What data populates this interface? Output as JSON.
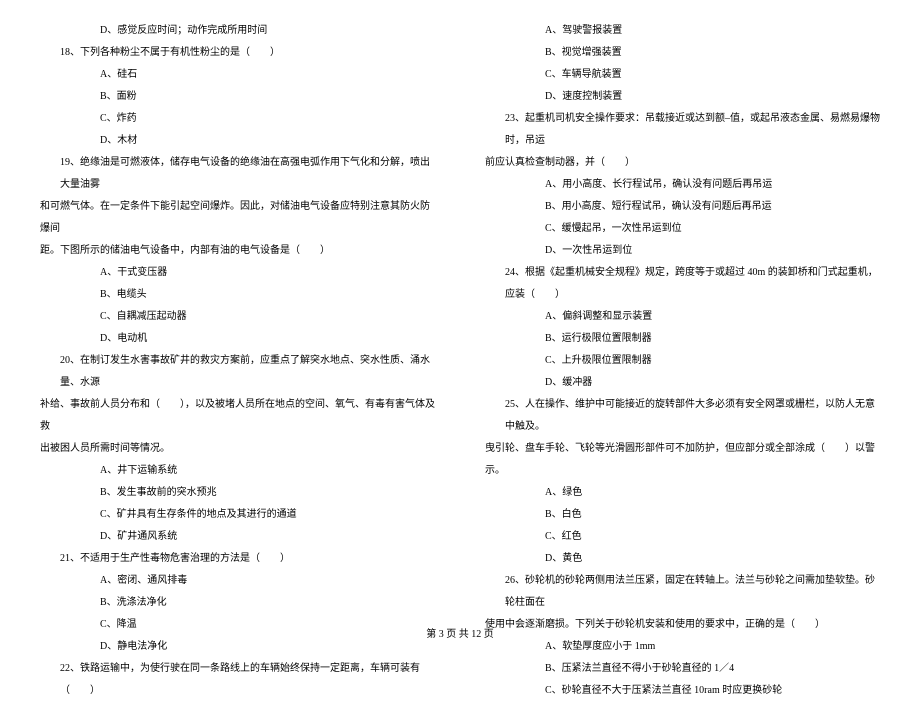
{
  "left_column": {
    "q17_opt_d": "D、感觉反应时间；动作完成所用时间",
    "q18_text": "18、下列各种粉尘不属于有机性粉尘的是（　　）",
    "q18_opt_a": "A、硅石",
    "q18_opt_b": "B、面粉",
    "q18_opt_c": "C、炸药",
    "q18_opt_d": "D、木材",
    "q19_text_l1": "19、绝缘油是可燃液体，储存电气设备的绝缘油在高强电弧作用下气化和分解，喷出大量油雾",
    "q19_text_l2": "和可燃气体。在一定条件下能引起空间爆炸。因此，对储油电气设备应特别注意其防火防爆间",
    "q19_text_l3": "距。下图所示的储油电气设备中，内部有油的电气设备是（　　）",
    "q19_opt_a": "A、干式变压器",
    "q19_opt_b": "B、电缆头",
    "q19_opt_c": "C、自耦减压起动器",
    "q19_opt_d": "D、电动机",
    "q20_text_l1": "20、在制订发生水害事故矿井的救灾方案前，应重点了解突水地点、突水性质、涌水量、水源",
    "q20_text_l2": "补给、事故前人员分布和（　　），以及被堵人员所在地点的空间、氧气、有毒有害气体及救",
    "q20_text_l3": "出被困人员所需时间等情况。",
    "q20_opt_a": "A、井下运输系统",
    "q20_opt_b": "B、发生事故前的突水预兆",
    "q20_opt_c": "C、矿井具有生存条件的地点及其进行的通道",
    "q20_opt_d": "D、矿井通风系统",
    "q21_text": "21、不适用于生产性毒物危害治理的方法是（　　）",
    "q21_opt_a": "A、密闭、通风排毒",
    "q21_opt_b": "B、洗涤法净化",
    "q21_opt_c": "C、降温",
    "q21_opt_d": "D、静电法净化",
    "q22_text": "22、铁路运输中，为使行驶在同一条路线上的车辆始终保持一定距离，车辆可装有（　　）"
  },
  "right_column": {
    "q22_opt_a": "A、驾驶警报装置",
    "q22_opt_b": "B、视觉增强装置",
    "q22_opt_c": "C、车辆导航装置",
    "q22_opt_d": "D、速度控制装置",
    "q23_text_l1": "23、起重机司机安全操作要求：吊载接近或达到额–值，或起吊液态金属、易燃易爆物时，吊运",
    "q23_text_l2": "前应认真检查制动器，并（　　）",
    "q23_opt_a": "A、用小高度、长行程试吊，确认没有问题后再吊运",
    "q23_opt_b": "B、用小高度、短行程试吊，确认没有问题后再吊运",
    "q23_opt_c": "C、缓慢起吊，一次性吊运到位",
    "q23_opt_d": "D、一次性吊运到位",
    "q24_text": "24、根据《起重机械安全规程》规定，跨度等于或超过 40m 的装卸桥和门式起重机，应装（　　）",
    "q24_opt_a": "A、偏斜调整和显示装置",
    "q24_opt_b": "B、运行极限位置限制器",
    "q24_opt_c": "C、上升极限位置限制器",
    "q24_opt_d": "D、缓冲器",
    "q25_text_l1": "25、人在操作、维护中可能接近的旋转部件大多必须有安全网罩或栅栏，以防人无意中触及。",
    "q25_text_l2": "曳引轮、盘车手轮、飞轮等光滑圆形部件可不加防护，但应部分或全部涂成（　　）以警示。",
    "q25_opt_a": "A、绿色",
    "q25_opt_b": "B、白色",
    "q25_opt_c": "C、红色",
    "q25_opt_d": "D、黄色",
    "q26_text_l1": "26、砂轮机的砂轮两侧用法兰压紧，固定在转轴上。法兰与砂轮之间需加垫软垫。砂轮柱面在",
    "q26_text_l2": "使用中会逐渐磨损。下列关于砂轮机安装和使用的要求中，正确的是（　　）",
    "q26_opt_a": "A、软垫厚度应小于 1mm",
    "q26_opt_b": "B、压紧法兰直径不得小于砂轮直径的 1／4",
    "q26_opt_c": "C、砂轮直径不大于压紧法兰直径 10ram 时应更换砂轮"
  },
  "footer": {
    "text": "第 3 页 共 12 页"
  }
}
